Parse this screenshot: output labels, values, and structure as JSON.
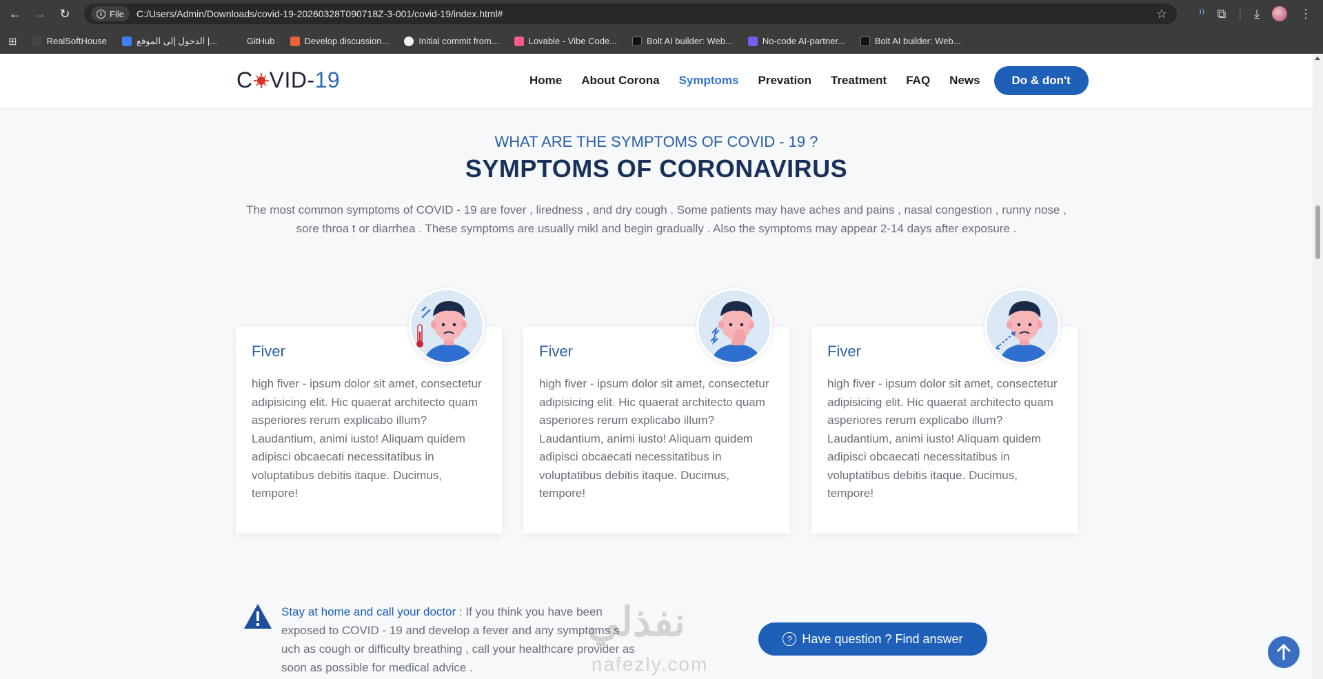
{
  "browser": {
    "file_chip": "File",
    "url": "C:/Users/Admin/Downloads/covid-19-20260328T090718Z-3-001/covid-19/index.html#",
    "bookmarks": [
      {
        "label": "RealSoftHouse",
        "color": "#444444"
      },
      {
        "label": "الدخول إلى الموقع |...",
        "color": "#3b82f6"
      },
      {
        "label": "GitHub",
        "color": "#3c3c3c"
      },
      {
        "label": "Develop discussion...",
        "color": "#e8643a"
      },
      {
        "label": "Initial commit from...",
        "color": "#f0f0f0"
      },
      {
        "label": "Lovable - Vibe Code...",
        "color": "#ff5a8a"
      },
      {
        "label": "Bolt AI builder: Web...",
        "color": "#111111"
      },
      {
        "label": "No-code AI-partner...",
        "color": "#7b5cf5"
      },
      {
        "label": "Bolt AI builder: Web...",
        "color": "#111111"
      }
    ]
  },
  "site": {
    "logo": {
      "text": "C",
      "text2": "VID-",
      "num": "19"
    },
    "nav": [
      {
        "label": "Home",
        "active": false
      },
      {
        "label": "About Corona",
        "active": false
      },
      {
        "label": "Symptoms",
        "active": true
      },
      {
        "label": "Prevation",
        "active": false
      },
      {
        "label": "Treatment",
        "active": false
      },
      {
        "label": "FAQ",
        "active": false
      },
      {
        "label": "News",
        "active": false
      }
    ],
    "cta": "Do & don't"
  },
  "section": {
    "kicker": "WHAT ARE THE SYMPTOMS OF COVID - 19 ?",
    "heading": "SYMPTOMS OF CORONAVIRUS",
    "intro": "The most common symptoms of COVID - 19 are fover , liredness , and dry cough . Some patients may have aches and pains , nasal congestion , runny nose , sore throa t or diarrhea . These symptoms are usually mikl and begin gradually . Also the symptoms may appear 2-14 days after exposure ."
  },
  "cards": [
    {
      "title": "Fiver",
      "icon": "fever-thermometer-icon",
      "body": "high fiver - ipsum dolor sit amet, consectetur adipisicing elit. Hic quaerat architecto quam asperiores rerum explicabo illum? Laudantium, animi iusto! Aliquam quidem adipisci obcaecati necessitatibus in voluptatibus debitis itaque. Ducimus, tempore!"
    },
    {
      "title": "Fiver",
      "icon": "cough-icon",
      "body": "high fiver - ipsum dolor sit amet, consectetur adipisicing elit. Hic quaerat architecto quam asperiores rerum explicabo illum? Laudantium, animi iusto! Aliquam quidem adipisci obcaecati necessitatibus in voluptatibus debitis itaque. Ducimus, tempore!"
    },
    {
      "title": "Fiver",
      "icon": "breathing-difficulty-icon",
      "body": "high fiver - ipsum dolor sit amet, consectetur adipisicing elit. Hic quaerat architecto quam asperiores rerum explicabo illum? Laudantium, animi iusto! Aliquam quidem adipisci obcaecati necessitatibus in voluptatibus debitis itaque. Ducimus, tempore!"
    }
  ],
  "advice": {
    "lead": "Stay at home and call your doctor",
    "text": " : If you think you have been exposed to COVID - 19 and develop a fever and any symptoms s uch as cough or difficulty breathing , call your healthcare provider as soon as possible for medical advice ."
  },
  "faq_button": "Have question ? Find answer",
  "watermark": {
    "ar": "نفذلي",
    "lat": "nafezly.com"
  },
  "colors": {
    "primary": "#1e5fb8",
    "heading": "#19315a",
    "accent_text": "#2a5fa8"
  }
}
